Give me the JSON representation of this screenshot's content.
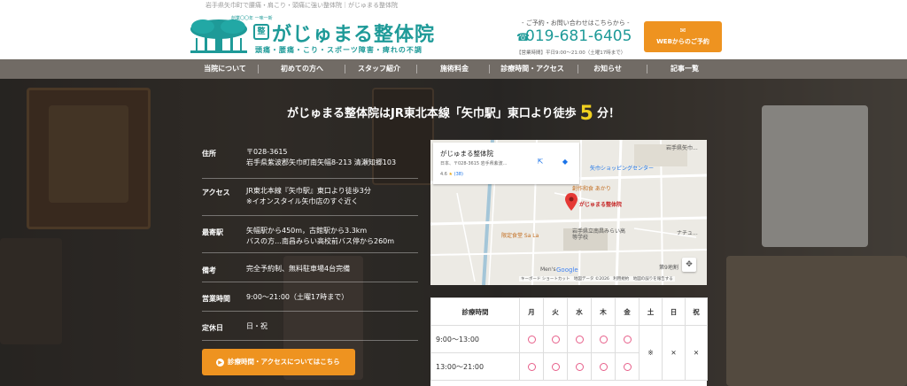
{
  "top_strip": "岩手県矢巾町で腰痛・肩こり・頭痛に強い整体院｜がじゅまる整体院",
  "logo": {
    "name": "がじゅまる整体院",
    "badge": "整",
    "sub": "頭痛・腰痛・こり・スポーツ障害・痺れの不調",
    "est": "創業〇〇年 一味一新"
  },
  "contact": {
    "lead": "- ご予約・お問い合わせはこちらから -",
    "tel": "019-681-6405",
    "hours": "【営業時間】平日9:00〜21:00（土曜17時まで）"
  },
  "web_button": {
    "icon": "mail-icon",
    "label": "WEBからのご予約"
  },
  "nav": [
    "当院について",
    "初めての方へ",
    "スタッフ紹介",
    "施術料金",
    "診療時間・アクセス",
    "お知らせ",
    "記事一覧"
  ],
  "headline": {
    "before": "がじゅまる整体院はJR東北本線「矢巾駅」東口より徒歩",
    "big": "5",
    "after": "分！"
  },
  "info": [
    {
      "label": "住所",
      "lines": [
        "〒028-3615",
        "岩手県紫波郡矢巾町南矢幅8-213 清瀬知郷103"
      ]
    },
    {
      "label": "アクセス",
      "lines": [
        "JR東北本線『矢巾駅』東口より徒歩3分",
        "※イオンスタイル矢巾店のすぐ近く"
      ]
    },
    {
      "label": "最寄駅",
      "lines": [
        "矢幅駅から450m，古館駅から3.3km",
        "バスの方…南昌みらい高校前バス停から260m"
      ]
    },
    {
      "label": "備考",
      "lines": [
        "完全予約制、無料駐車場4台完備"
      ]
    },
    {
      "label": "営業時間",
      "lines": [
        "9:00～21:00（土曜17時まで）"
      ]
    },
    {
      "label": "定休日",
      "lines": [
        "日・祝"
      ]
    }
  ],
  "access_button": "診療時間・アクセスについてはこちら",
  "map": {
    "place": "がじゅまる整体院",
    "address": "日本、〒028-3615 岩手県紫波...",
    "rating": "4.6",
    "stars": "★",
    "reviews": "(38)",
    "pin_label": "がじゅまる整体院",
    "labels": [
      "矢巾ショッピングセンター",
      "創作和食 あかり",
      "限定食堂 Sa La",
      "岩手県立南昌みらい高等学校",
      "Men's",
      "第9地割",
      "岩手県矢巾...",
      "ナチュ..."
    ],
    "footer": "キーボード ショートカット　地図データ ©2026　利用規約　地図の誤りを報告する",
    "google": "Google"
  },
  "schedule": {
    "header": [
      "診療時間",
      "月",
      "火",
      "水",
      "木",
      "金",
      "土",
      "日",
      "祝"
    ],
    "rows": [
      {
        "time": "9:00～13:00",
        "cells": [
          "○",
          "○",
          "○",
          "○",
          "○",
          "※",
          "✕",
          "✕"
        ]
      },
      {
        "time": "13:00～21:00",
        "cells": [
          "○",
          "○",
          "○",
          "○",
          "○",
          "※",
          "✕",
          "✕"
        ]
      }
    ]
  },
  "colors": {
    "accent": "#1e9a98",
    "orange": "#ee9320",
    "nav": "#76706a",
    "highlight": "#f0d020"
  }
}
